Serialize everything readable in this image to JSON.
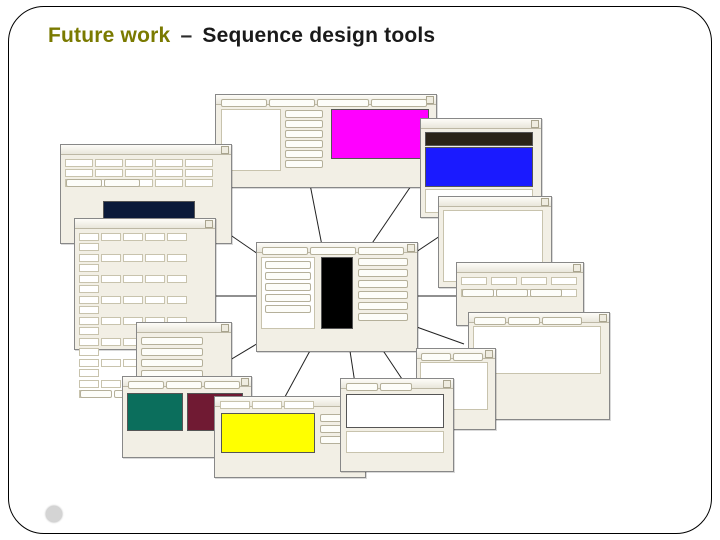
{
  "title": {
    "accent": "Future work",
    "dash": "–",
    "rest": "Sequence design tools"
  },
  "swatches": {
    "magenta": "#ff00ff",
    "darkbrown": "#2a2418",
    "blue": "#1a1aff",
    "navy": "#0b1a3a",
    "black": "#000000",
    "teal": "#0b6e5c",
    "maroon": "#701a33",
    "yellow": "#ffff00",
    "white": "#ffffff"
  },
  "windows": {
    "topCenter": "panel",
    "topRightA": "panel",
    "topRightB": "panel",
    "leftTop": "panel",
    "leftMid": "panel",
    "leftBottom": "panel",
    "centerHub": "panel",
    "rightA": "panel",
    "rightB": "panel",
    "rightC": "panel",
    "bottomA": "panel",
    "bottomB": "panel",
    "bottomC": "panel",
    "smallExtra": "panel"
  }
}
